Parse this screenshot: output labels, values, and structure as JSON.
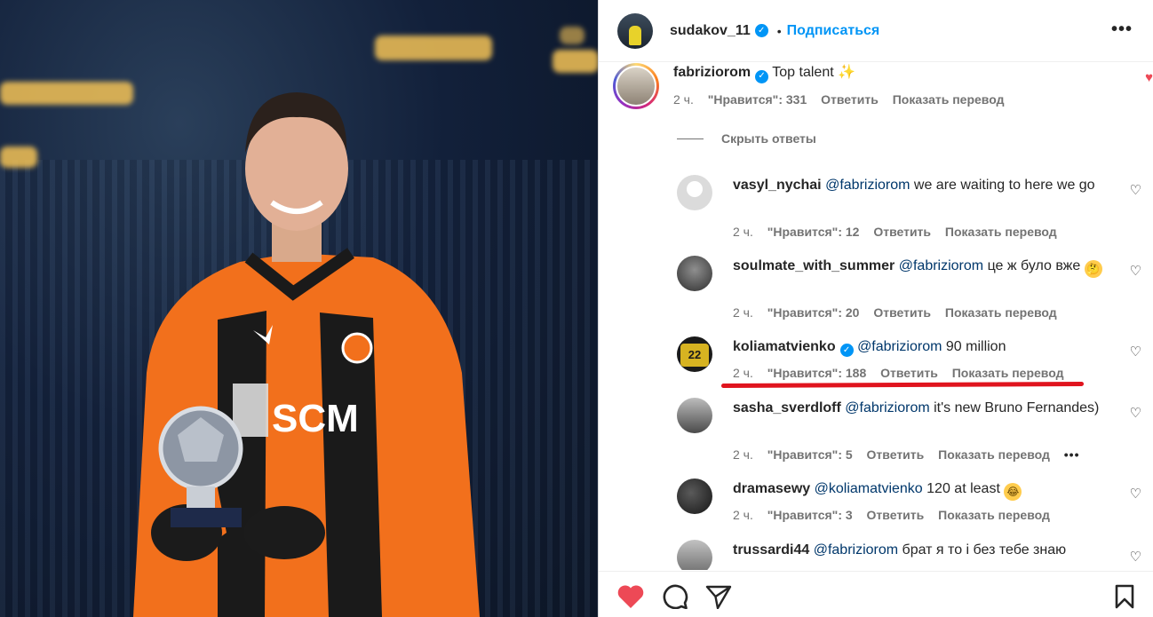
{
  "post": {
    "author": "sudakov_11",
    "separator": "•",
    "follow_label": "Подписаться",
    "more_label": "•••"
  },
  "main_comment": {
    "username": "fabriziorom",
    "text": "Top talent",
    "emoji": "✨",
    "time": "2 ч.",
    "likes": "\"Нравится\": 331",
    "reply_label": "Ответить",
    "translate_label": "Показать перевод"
  },
  "hide_replies_label": "Скрыть ответы",
  "replies": [
    {
      "username": "vasyl_nychai",
      "mention": "@fabriziorom",
      "text": "we are waiting to here we go",
      "time": "2 ч.",
      "likes": "\"Нравится\": 12",
      "reply_label": "Ответить",
      "translate_label": "Показать перевод"
    },
    {
      "username": "soulmate_with_summer",
      "mention": "@fabriziorom",
      "text": "це ж було вже",
      "emoji": "🤔",
      "time": "2 ч.",
      "likes": "\"Нравится\": 20",
      "reply_label": "Ответить",
      "translate_label": "Показать перевод"
    },
    {
      "username": "koliamatvienko",
      "mention": "@fabriziorom",
      "text": "90 million",
      "time": "2 ч.",
      "likes": "\"Нравится\": 188",
      "reply_label": "Ответить",
      "translate_label": "Показать перевод"
    },
    {
      "username": "sasha_sverdloff",
      "mention": "@fabriziorom",
      "text": "it's new Bruno Fernandes)",
      "time": "2 ч.",
      "likes": "\"Нравится\": 5",
      "reply_label": "Ответить",
      "translate_label": "Показать перевод",
      "more": "•••"
    },
    {
      "username": "dramasewy",
      "mention": "@koliamatvienko",
      "text": "120 at least",
      "emoji": "😂",
      "time": "2 ч.",
      "likes": "\"Нравится\": 3",
      "reply_label": "Ответить",
      "translate_label": "Показать перевод"
    },
    {
      "username": "trussardi44",
      "mention": "@fabriziorom",
      "text": "брат я то і без тебе знаю"
    }
  ],
  "colors": {
    "accent": "#0095f6",
    "like_red": "#ed4956",
    "annotation_red": "#e0141e"
  },
  "icons": [
    "verified-icon",
    "heart-icon",
    "comment-icon",
    "share-icon",
    "bookmark-icon"
  ]
}
